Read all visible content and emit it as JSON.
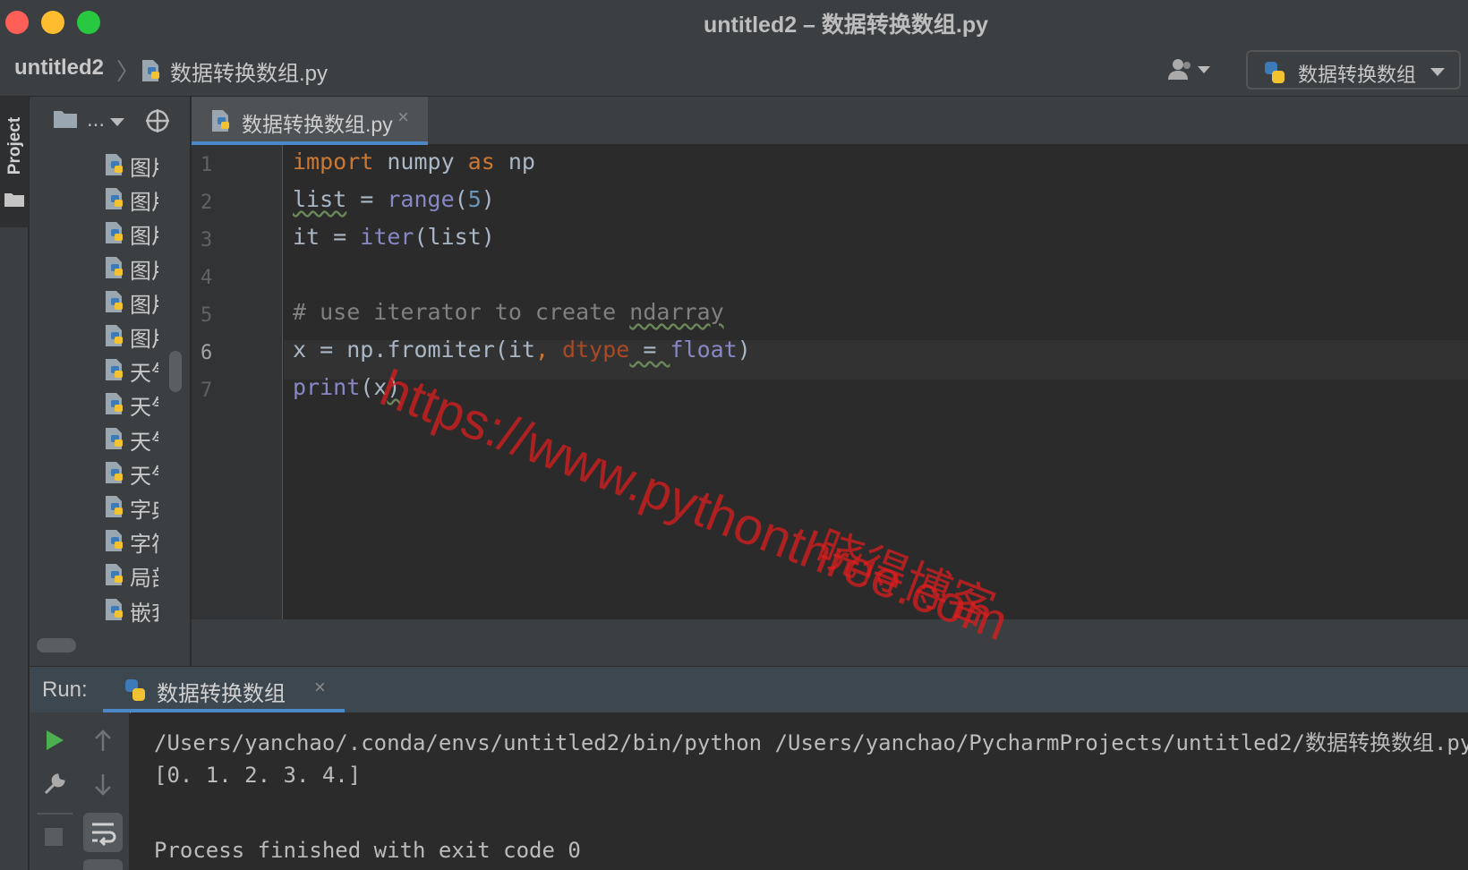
{
  "window": {
    "title": "untitled2 – 数据转换数组.py"
  },
  "navbar": {
    "project": "untitled2",
    "separator": "〉",
    "file": "数据转换数组.py",
    "run_config": "数据转换数组"
  },
  "left_strip": {
    "project_tab": "Project"
  },
  "project_panel": {
    "dots": "...",
    "files": [
      {
        "label": "图片"
      },
      {
        "label": "图片"
      },
      {
        "label": "图片"
      },
      {
        "label": "图片"
      },
      {
        "label": "图片"
      },
      {
        "label": "图片"
      },
      {
        "label": "天气"
      },
      {
        "label": "天气"
      },
      {
        "label": "天气"
      },
      {
        "label": "天气"
      },
      {
        "label": "字典"
      },
      {
        "label": "字符"
      },
      {
        "label": "局部"
      },
      {
        "label": "嵌套"
      }
    ]
  },
  "editor": {
    "tab_label": "数据转换数组.py",
    "tab_close": "×",
    "active_line": 6,
    "line_numbers": [
      "1",
      "2",
      "3",
      "4",
      "5",
      "6",
      "7"
    ],
    "code": {
      "l1": {
        "kw1": "import",
        "t1": " numpy ",
        "kw2": "as",
        "t2": " np"
      },
      "l2": {
        "t1": "list",
        "t2": " = ",
        "bi": "range",
        "t3": "(",
        "num": "5",
        "t4": ")"
      },
      "l3": {
        "t1": "it = ",
        "bi": "iter",
        "t2": "(list)"
      },
      "l5": {
        "cm1": "# use iterator to create ",
        "cm2": "ndarray"
      },
      "l6": {
        "t1": "x = np.fromiter(it",
        "t2": ", ",
        "param": "dtype",
        "t3": " = ",
        "bi": "float",
        "t4": ")"
      },
      "l7": {
        "bi": "print",
        "t1": "(x",
        "t2": ")"
      }
    }
  },
  "watermark": {
    "url": "https://www.pythonthree.com",
    "cn": "晓得博客"
  },
  "run": {
    "label": "Run:",
    "tab_label": "数据转换数组",
    "tab_close": "×",
    "output": [
      "/Users/yanchao/.conda/envs/untitled2/bin/python /Users/yanchao/PycharmProjects/untitled2/数据转换数组.py",
      "[0. 1. 2. 3. 4.]",
      "",
      "Process finished with exit code 0"
    ]
  },
  "colors": {
    "accent": "#4a88c7",
    "keyword": "#cc7832",
    "builtin": "#8888c6",
    "number": "#6897bb",
    "comment": "#808080",
    "watermark": "#dc1e1e"
  }
}
